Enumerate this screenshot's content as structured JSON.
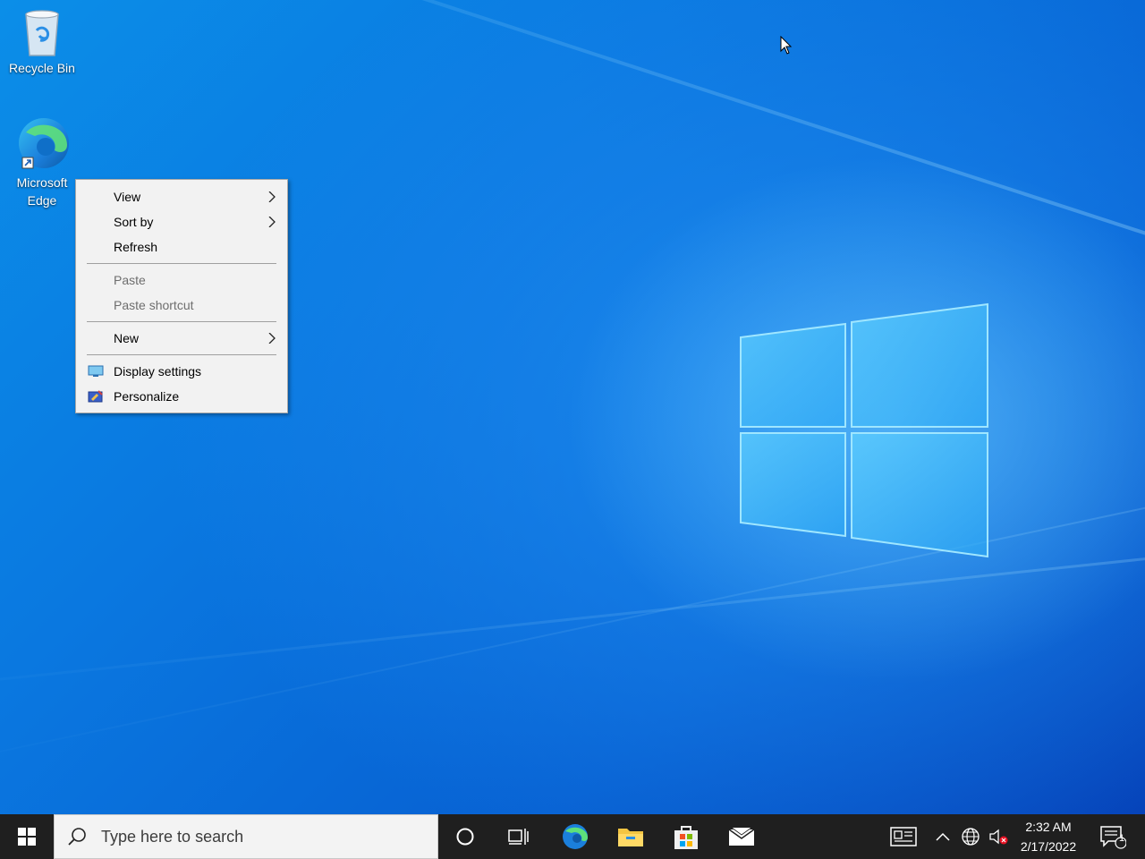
{
  "desktop_icons": [
    {
      "label": "Recycle Bin",
      "icon": "recycle-bin-icon"
    },
    {
      "label": "Microsoft Edge",
      "icon": "edge-icon"
    }
  ],
  "context_menu": {
    "view": "View",
    "sort_by": "Sort by",
    "refresh": "Refresh",
    "paste": "Paste",
    "paste_shortcut": "Paste shortcut",
    "new": "New",
    "display_settings": "Display settings",
    "personalize": "Personalize"
  },
  "taskbar": {
    "search_placeholder": "Type here to search",
    "time": "2:32 AM",
    "date": "2/17/2022",
    "notification_count": "1",
    "pinned": [
      "cortana-icon",
      "task-view-icon",
      "edge-icon",
      "file-explorer-icon",
      "store-icon",
      "mail-icon"
    ]
  },
  "colors": {
    "taskbar": "#1f1f1f",
    "menu_bg": "#f2f2f2",
    "accent": "#0a6ad8"
  }
}
